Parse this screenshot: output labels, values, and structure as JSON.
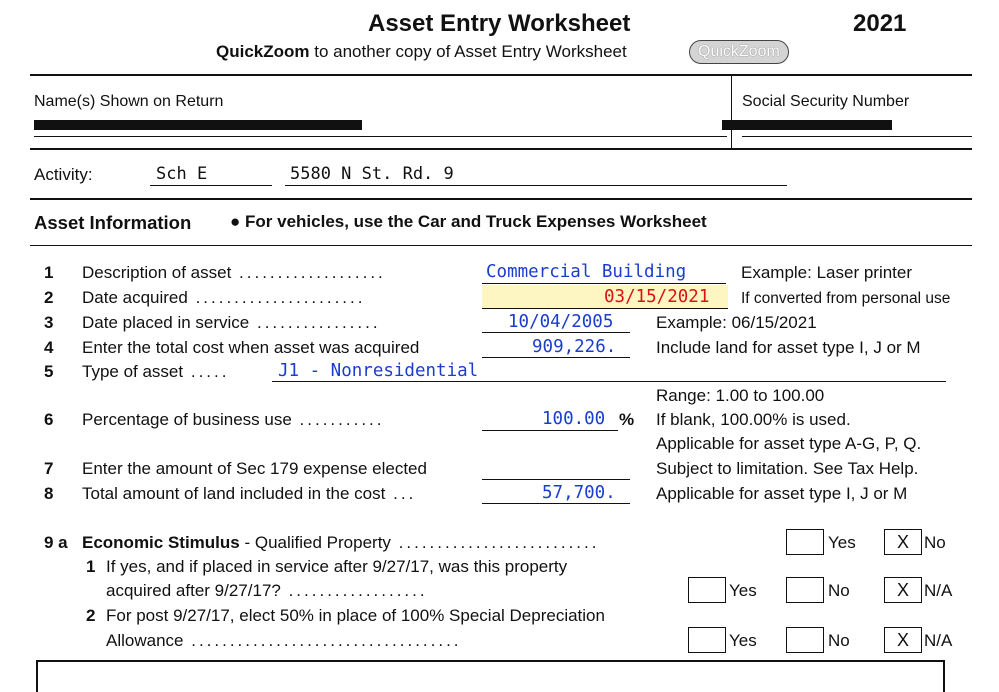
{
  "header": {
    "title": "Asset Entry Worksheet",
    "year": "2021",
    "quickzoom_bold": "QuickZoom",
    "quickzoom_text": "to another copy of Asset Entry Worksheet",
    "quickzoom_button": "QuickZoom"
  },
  "names": {
    "name_label": "Name(s) Shown on Return",
    "ssn_label": "Social Security Number"
  },
  "activity": {
    "label": "Activity:",
    "schedule": "Sch E",
    "address": "5580 N St. Rd. 9"
  },
  "asset_info": {
    "heading": "Asset Information",
    "note": "For vehicles, use the Car and Truck Expenses Worksheet"
  },
  "lines": [
    {
      "num": "1",
      "label": "Description of asset",
      "value": "Commercial Building",
      "hint": "Example: Laser printer"
    },
    {
      "num": "2",
      "label": "Date acquired",
      "value": "03/15/2021",
      "hint": "If converted from personal use"
    },
    {
      "num": "3",
      "label": "Date placed in service",
      "value": "10/04/2005",
      "hint": "Example: 06/15/2021"
    },
    {
      "num": "4",
      "label": "Enter the total cost when asset was acquired",
      "value": "909,226.",
      "hint": "Include land for asset type I, J or M"
    },
    {
      "num": "5",
      "label": "Type of asset",
      "value": "J1 - Nonresidential",
      "hint": ""
    },
    {
      "num": "6",
      "label": "Percentage of business use",
      "value": "100.00",
      "suffix": "%",
      "hint_range": "Range: 1.00 to 100.00",
      "hint": "If blank, 100.00% is used.",
      "hint2": "Applicable for asset type A-G, P, Q."
    },
    {
      "num": "7",
      "label": "Enter the amount of Sec 179 expense elected",
      "value": "",
      "hint": "Subject to limitation. See Tax Help."
    },
    {
      "num": "8",
      "label": "Total amount of land included in the cost",
      "value": "57,700.",
      "hint": "Applicable for asset type I, J or M"
    }
  ],
  "line9": {
    "num": "9 a",
    "label_bold": "Economic Stimulus",
    "label_rest": "- Qualified Property",
    "yes": "Yes",
    "no": "No",
    "no_mark": "X",
    "sub1_num": "1",
    "sub1_text_a": "If yes, and if placed in service after 9/27/17, was this property",
    "sub1_text_b": "acquired after 9/27/17?",
    "sub1_yes": "Yes",
    "sub1_no": "No",
    "sub1_na": "N/A",
    "sub1_mark": "X",
    "sub2_num": "2",
    "sub2_text_a": "For post 9/27/17, elect 50% in place of 100% Special Depreciation",
    "sub2_text_b": "Allowance",
    "sub2_yes": "Yes",
    "sub2_no": "No",
    "sub2_na": "N/A",
    "sub2_mark": "X"
  }
}
